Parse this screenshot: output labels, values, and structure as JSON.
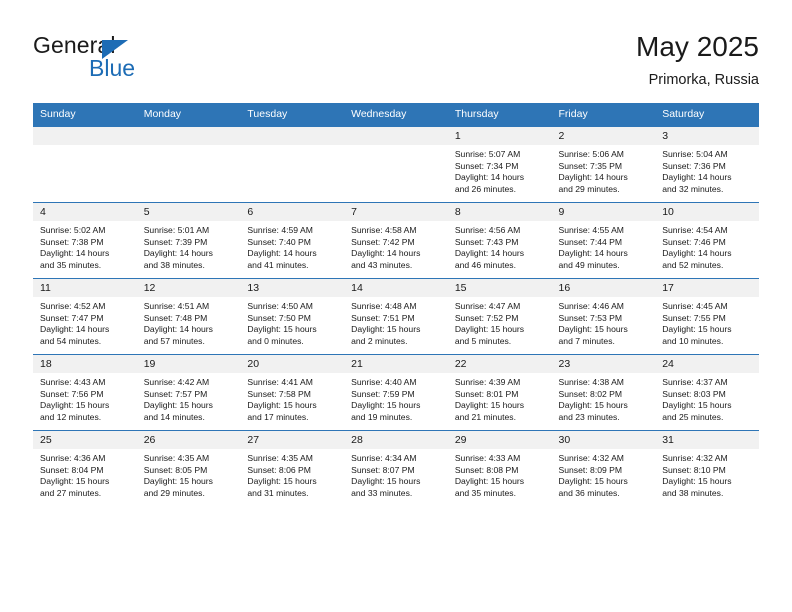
{
  "brand": {
    "word_one": "General",
    "word_two": "Blue",
    "triangle_icon": "brand-triangle-icon",
    "accent_color": "#1d6cb5"
  },
  "header": {
    "title": "May 2025",
    "subtitle": "Primorka, Russia"
  },
  "theme": {
    "header_blue": "#2e75b6",
    "daynum_band": "#f1f1f1",
    "text": "#1a1a1a"
  },
  "calendar": {
    "weekday_headers": [
      "Sunday",
      "Monday",
      "Tuesday",
      "Wednesday",
      "Thursday",
      "Friday",
      "Saturday"
    ],
    "weeks": [
      [
        {
          "day": "",
          "lines": []
        },
        {
          "day": "",
          "lines": []
        },
        {
          "day": "",
          "lines": []
        },
        {
          "day": "",
          "lines": []
        },
        {
          "day": "1",
          "lines": [
            "Sunrise: 5:07 AM",
            "Sunset: 7:34 PM",
            "Daylight: 14 hours",
            "and 26 minutes."
          ]
        },
        {
          "day": "2",
          "lines": [
            "Sunrise: 5:06 AM",
            "Sunset: 7:35 PM",
            "Daylight: 14 hours",
            "and 29 minutes."
          ]
        },
        {
          "day": "3",
          "lines": [
            "Sunrise: 5:04 AM",
            "Sunset: 7:36 PM",
            "Daylight: 14 hours",
            "and 32 minutes."
          ]
        }
      ],
      [
        {
          "day": "4",
          "lines": [
            "Sunrise: 5:02 AM",
            "Sunset: 7:38 PM",
            "Daylight: 14 hours",
            "and 35 minutes."
          ]
        },
        {
          "day": "5",
          "lines": [
            "Sunrise: 5:01 AM",
            "Sunset: 7:39 PM",
            "Daylight: 14 hours",
            "and 38 minutes."
          ]
        },
        {
          "day": "6",
          "lines": [
            "Sunrise: 4:59 AM",
            "Sunset: 7:40 PM",
            "Daylight: 14 hours",
            "and 41 minutes."
          ]
        },
        {
          "day": "7",
          "lines": [
            "Sunrise: 4:58 AM",
            "Sunset: 7:42 PM",
            "Daylight: 14 hours",
            "and 43 minutes."
          ]
        },
        {
          "day": "8",
          "lines": [
            "Sunrise: 4:56 AM",
            "Sunset: 7:43 PM",
            "Daylight: 14 hours",
            "and 46 minutes."
          ]
        },
        {
          "day": "9",
          "lines": [
            "Sunrise: 4:55 AM",
            "Sunset: 7:44 PM",
            "Daylight: 14 hours",
            "and 49 minutes."
          ]
        },
        {
          "day": "10",
          "lines": [
            "Sunrise: 4:54 AM",
            "Sunset: 7:46 PM",
            "Daylight: 14 hours",
            "and 52 minutes."
          ]
        }
      ],
      [
        {
          "day": "11",
          "lines": [
            "Sunrise: 4:52 AM",
            "Sunset: 7:47 PM",
            "Daylight: 14 hours",
            "and 54 minutes."
          ]
        },
        {
          "day": "12",
          "lines": [
            "Sunrise: 4:51 AM",
            "Sunset: 7:48 PM",
            "Daylight: 14 hours",
            "and 57 minutes."
          ]
        },
        {
          "day": "13",
          "lines": [
            "Sunrise: 4:50 AM",
            "Sunset: 7:50 PM",
            "Daylight: 15 hours",
            "and 0 minutes."
          ]
        },
        {
          "day": "14",
          "lines": [
            "Sunrise: 4:48 AM",
            "Sunset: 7:51 PM",
            "Daylight: 15 hours",
            "and 2 minutes."
          ]
        },
        {
          "day": "15",
          "lines": [
            "Sunrise: 4:47 AM",
            "Sunset: 7:52 PM",
            "Daylight: 15 hours",
            "and 5 minutes."
          ]
        },
        {
          "day": "16",
          "lines": [
            "Sunrise: 4:46 AM",
            "Sunset: 7:53 PM",
            "Daylight: 15 hours",
            "and 7 minutes."
          ]
        },
        {
          "day": "17",
          "lines": [
            "Sunrise: 4:45 AM",
            "Sunset: 7:55 PM",
            "Daylight: 15 hours",
            "and 10 minutes."
          ]
        }
      ],
      [
        {
          "day": "18",
          "lines": [
            "Sunrise: 4:43 AM",
            "Sunset: 7:56 PM",
            "Daylight: 15 hours",
            "and 12 minutes."
          ]
        },
        {
          "day": "19",
          "lines": [
            "Sunrise: 4:42 AM",
            "Sunset: 7:57 PM",
            "Daylight: 15 hours",
            "and 14 minutes."
          ]
        },
        {
          "day": "20",
          "lines": [
            "Sunrise: 4:41 AM",
            "Sunset: 7:58 PM",
            "Daylight: 15 hours",
            "and 17 minutes."
          ]
        },
        {
          "day": "21",
          "lines": [
            "Sunrise: 4:40 AM",
            "Sunset: 7:59 PM",
            "Daylight: 15 hours",
            "and 19 minutes."
          ]
        },
        {
          "day": "22",
          "lines": [
            "Sunrise: 4:39 AM",
            "Sunset: 8:01 PM",
            "Daylight: 15 hours",
            "and 21 minutes."
          ]
        },
        {
          "day": "23",
          "lines": [
            "Sunrise: 4:38 AM",
            "Sunset: 8:02 PM",
            "Daylight: 15 hours",
            "and 23 minutes."
          ]
        },
        {
          "day": "24",
          "lines": [
            "Sunrise: 4:37 AM",
            "Sunset: 8:03 PM",
            "Daylight: 15 hours",
            "and 25 minutes."
          ]
        }
      ],
      [
        {
          "day": "25",
          "lines": [
            "Sunrise: 4:36 AM",
            "Sunset: 8:04 PM",
            "Daylight: 15 hours",
            "and 27 minutes."
          ]
        },
        {
          "day": "26",
          "lines": [
            "Sunrise: 4:35 AM",
            "Sunset: 8:05 PM",
            "Daylight: 15 hours",
            "and 29 minutes."
          ]
        },
        {
          "day": "27",
          "lines": [
            "Sunrise: 4:35 AM",
            "Sunset: 8:06 PM",
            "Daylight: 15 hours",
            "and 31 minutes."
          ]
        },
        {
          "day": "28",
          "lines": [
            "Sunrise: 4:34 AM",
            "Sunset: 8:07 PM",
            "Daylight: 15 hours",
            "and 33 minutes."
          ]
        },
        {
          "day": "29",
          "lines": [
            "Sunrise: 4:33 AM",
            "Sunset: 8:08 PM",
            "Daylight: 15 hours",
            "and 35 minutes."
          ]
        },
        {
          "day": "30",
          "lines": [
            "Sunrise: 4:32 AM",
            "Sunset: 8:09 PM",
            "Daylight: 15 hours",
            "and 36 minutes."
          ]
        },
        {
          "day": "31",
          "lines": [
            "Sunrise: 4:32 AM",
            "Sunset: 8:10 PM",
            "Daylight: 15 hours",
            "and 38 minutes."
          ]
        }
      ]
    ]
  }
}
